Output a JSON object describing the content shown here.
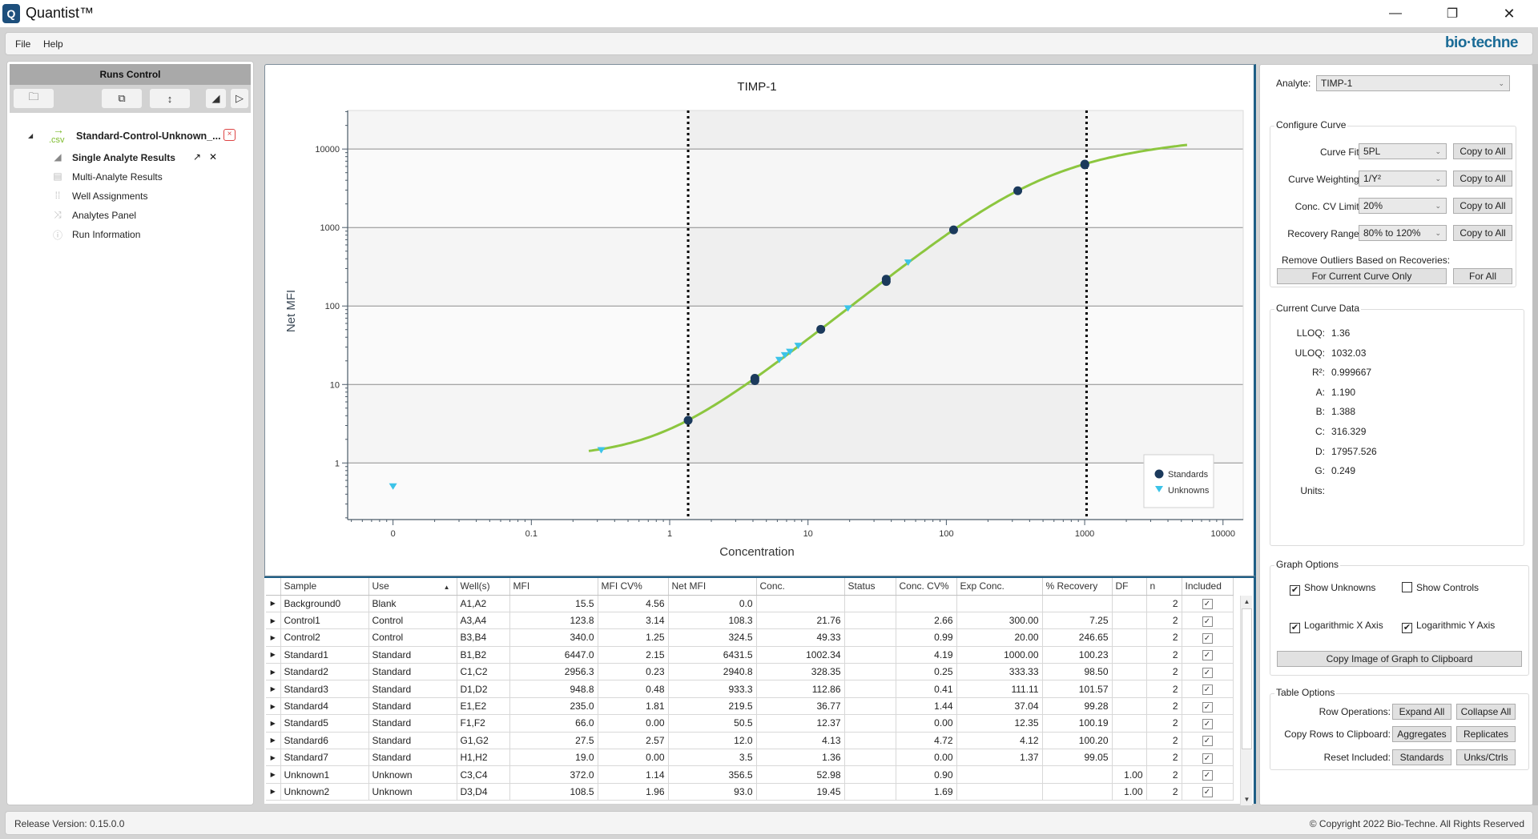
{
  "window": {
    "title": "Quantist™",
    "app_icon": "quantist-logo-icon",
    "controls": {
      "minimize": "—",
      "maximize": "❐",
      "close": "✕"
    }
  },
  "menu": {
    "items": [
      "File",
      "Help"
    ],
    "brand": "bio·techne"
  },
  "sidebar": {
    "header": "Runs Control",
    "toolbar": [
      {
        "name": "open-folder-icon",
        "glyph": "🗀"
      },
      {
        "name": "copy-icon",
        "glyph": "⧉"
      },
      {
        "name": "sort-icon",
        "glyph": "↕"
      },
      {
        "name": "expand-triangle-icon",
        "glyph": "◢"
      },
      {
        "name": "play-icon",
        "glyph": "▷"
      }
    ],
    "run": {
      "ext": ".csv",
      "label": "Standard-Control-Unknown_...",
      "close": "×"
    },
    "items": [
      {
        "label": "Single Analyte Results",
        "icon": "bar-chart-icon",
        "glyph": "📶",
        "active": true,
        "popout": "↗",
        "close": "✕"
      },
      {
        "label": "Multi-Analyte Results",
        "icon": "clipboard-icon",
        "glyph": "▤"
      },
      {
        "label": "Well Assignments",
        "icon": "grid-icon",
        "glyph": "⁞⁞"
      },
      {
        "label": "Analytes Panel",
        "icon": "shuffle-icon",
        "glyph": "⤨"
      },
      {
        "label": "Run Information",
        "icon": "info-icon",
        "glyph": "ⓘ"
      }
    ]
  },
  "chart_data": {
    "type": "scatter",
    "title": "TIMP-1",
    "xlabel": "Concentration",
    "ylabel": "Net MFI",
    "x_scale": "log",
    "y_scale": "log",
    "xlim": [
      0.0047,
      14000
    ],
    "ylim": [
      0.19,
      31000
    ],
    "x_ticks": [
      {
        "value": 0.01,
        "label": "0"
      },
      {
        "value": 0.1,
        "label": "0.1"
      },
      {
        "value": 1,
        "label": "1"
      },
      {
        "value": 10,
        "label": "10"
      },
      {
        "value": 100,
        "label": "100"
      },
      {
        "value": 1000,
        "label": "1000"
      },
      {
        "value": 10000,
        "label": "10000"
      }
    ],
    "y_ticks": [
      {
        "value": 1,
        "label": "1"
      },
      {
        "value": 10,
        "label": "10"
      },
      {
        "value": 100,
        "label": "100"
      },
      {
        "value": 1000,
        "label": "1000"
      },
      {
        "value": 10000,
        "label": "10000"
      }
    ],
    "grid": true,
    "legend": {
      "position": "bottom-right",
      "entries": [
        "Standards",
        "Unknowns"
      ]
    },
    "lloq": 1.36,
    "uloq": 1032.03,
    "curve": {
      "model": "5PL",
      "A": 1.19,
      "B": 1.388,
      "C": 316.329,
      "D": 17957.526,
      "G": 0.249,
      "x_range": [
        0.26,
        5500
      ]
    },
    "series": [
      {
        "name": "Standards",
        "marker": "circle",
        "color": "#1b3a5c",
        "points": [
          {
            "x": 1002.34,
            "y": 6431.5
          },
          {
            "x": 1002.34,
            "y": 6300
          },
          {
            "x": 328.35,
            "y": 2940.8
          },
          {
            "x": 112.86,
            "y": 933.3
          },
          {
            "x": 36.77,
            "y": 219.5
          },
          {
            "x": 36.77,
            "y": 205
          },
          {
            "x": 12.37,
            "y": 50.5
          },
          {
            "x": 4.13,
            "y": 12.0
          },
          {
            "x": 4.13,
            "y": 11.2
          },
          {
            "x": 1.36,
            "y": 3.5
          }
        ]
      },
      {
        "name": "Unknowns",
        "marker": "triangle-down",
        "color": "#3cc3e8",
        "points": [
          {
            "x": 0.01,
            "y": 0.5
          },
          {
            "x": 0.32,
            "y": 1.45
          },
          {
            "x": 6.2,
            "y": 20.5
          },
          {
            "x": 6.8,
            "y": 23.5
          },
          {
            "x": 7.4,
            "y": 26
          },
          {
            "x": 8.5,
            "y": 31
          },
          {
            "x": 19.45,
            "y": 93.0
          },
          {
            "x": 52.98,
            "y": 356.5
          }
        ]
      }
    ]
  },
  "table": {
    "columns": [
      "",
      "Sample",
      "Use",
      "Well(s)",
      "MFI",
      "MFI CV%",
      "Net MFI",
      "Conc.",
      "Status",
      "Conc. CV%",
      "Exp Conc.",
      "% Recovery",
      "DF",
      "n",
      "Included"
    ],
    "sort_column": "Use",
    "rows": [
      [
        "Background0",
        "Blank",
        "A1,A2",
        "15.5",
        "4.56",
        "0.0",
        "",
        "",
        "",
        "",
        "",
        "",
        "2",
        true
      ],
      [
        "Control1",
        "Control",
        "A3,A4",
        "123.8",
        "3.14",
        "108.3",
        "21.76",
        "",
        "2.66",
        "300.00",
        "7.25",
        "",
        "2",
        true
      ],
      [
        "Control2",
        "Control",
        "B3,B4",
        "340.0",
        "1.25",
        "324.5",
        "49.33",
        "",
        "0.99",
        "20.00",
        "246.65",
        "",
        "2",
        true
      ],
      [
        "Standard1",
        "Standard",
        "B1,B2",
        "6447.0",
        "2.15",
        "6431.5",
        "1002.34",
        "",
        "4.19",
        "1000.00",
        "100.23",
        "",
        "2",
        true
      ],
      [
        "Standard2",
        "Standard",
        "C1,C2",
        "2956.3",
        "0.23",
        "2940.8",
        "328.35",
        "",
        "0.25",
        "333.33",
        "98.50",
        "",
        "2",
        true
      ],
      [
        "Standard3",
        "Standard",
        "D1,D2",
        "948.8",
        "0.48",
        "933.3",
        "112.86",
        "",
        "0.41",
        "111.11",
        "101.57",
        "",
        "2",
        true
      ],
      [
        "Standard4",
        "Standard",
        "E1,E2",
        "235.0",
        "1.81",
        "219.5",
        "36.77",
        "",
        "1.44",
        "37.04",
        "99.28",
        "",
        "2",
        true
      ],
      [
        "Standard5",
        "Standard",
        "F1,F2",
        "66.0",
        "0.00",
        "50.5",
        "12.37",
        "",
        "0.00",
        "12.35",
        "100.19",
        "",
        "2",
        true
      ],
      [
        "Standard6",
        "Standard",
        "G1,G2",
        "27.5",
        "2.57",
        "12.0",
        "4.13",
        "",
        "4.72",
        "4.12",
        "100.20",
        "",
        "2",
        true
      ],
      [
        "Standard7",
        "Standard",
        "H1,H2",
        "19.0",
        "0.00",
        "3.5",
        "1.36",
        "",
        "0.00",
        "1.37",
        "99.05",
        "",
        "2",
        true
      ],
      [
        "Unknown1",
        "Unknown",
        "C3,C4",
        "372.0",
        "1.14",
        "356.5",
        "52.98",
        "",
        "0.90",
        "",
        "",
        "1.00",
        "2",
        true
      ],
      [
        "Unknown2",
        "Unknown",
        "D3,D4",
        "108.5",
        "1.96",
        "93.0",
        "19.45",
        "",
        "1.69",
        "",
        "",
        "1.00",
        "2",
        true
      ]
    ]
  },
  "right_panel": {
    "analyte_label": "Analyte:",
    "analyte_value": "TIMP-1",
    "configure_curve": {
      "title": "Configure Curve",
      "rows": [
        {
          "label": "Curve Fit:",
          "value": "5PL",
          "button": "Copy to All"
        },
        {
          "label": "Curve Weighting:",
          "value": "1/Y²",
          "button": "Copy to All"
        },
        {
          "label": "Conc. CV Limit:",
          "value": "20%",
          "button": "Copy to All"
        },
        {
          "label": "Recovery Range:",
          "value": "80% to 120%",
          "button": "Copy to All"
        }
      ],
      "outliers_label": "Remove Outliers Based on Recoveries:",
      "outliers_current": "For Current Curve Only",
      "outliers_all": "For All"
    },
    "current_curve_data": {
      "title": "Current Curve Data",
      "items": [
        {
          "key": "LLOQ:",
          "value": "1.36"
        },
        {
          "key": "ULOQ:",
          "value": "1032.03"
        },
        {
          "key": "R²:",
          "value": "0.999667"
        },
        {
          "key": "A:",
          "value": "1.190"
        },
        {
          "key": "B:",
          "value": "1.388"
        },
        {
          "key": "C:",
          "value": "316.329"
        },
        {
          "key": "D:",
          "value": "17957.526"
        },
        {
          "key": "G:",
          "value": "0.249"
        },
        {
          "key": "Units:",
          "value": ""
        }
      ]
    },
    "graph_options": {
      "title": "Graph Options",
      "checkboxes": [
        {
          "label": "Show Unknowns",
          "checked": true
        },
        {
          "label": "Show Controls",
          "checked": false
        },
        {
          "label": "Logarithmic X Axis",
          "checked": true
        },
        {
          "label": "Logarithmic Y Axis",
          "checked": true
        }
      ],
      "copy_image": "Copy Image of Graph to Clipboard"
    },
    "table_options": {
      "title": "Table Options",
      "rows": [
        {
          "label": "Row Operations:",
          "b1": "Expand All",
          "b2": "Collapse All"
        },
        {
          "label": "Copy Rows to Clipboard:",
          "b1": "Aggregates",
          "b2": "Replicates"
        },
        {
          "label": "Reset Included:",
          "b1": "Standards",
          "b2": "Unks/Ctrls"
        }
      ]
    }
  },
  "status": {
    "version": "Release Version: 0.15.0.0",
    "copyright": "© Copyright 2022 Bio-Techne. All Rights Reserved"
  }
}
